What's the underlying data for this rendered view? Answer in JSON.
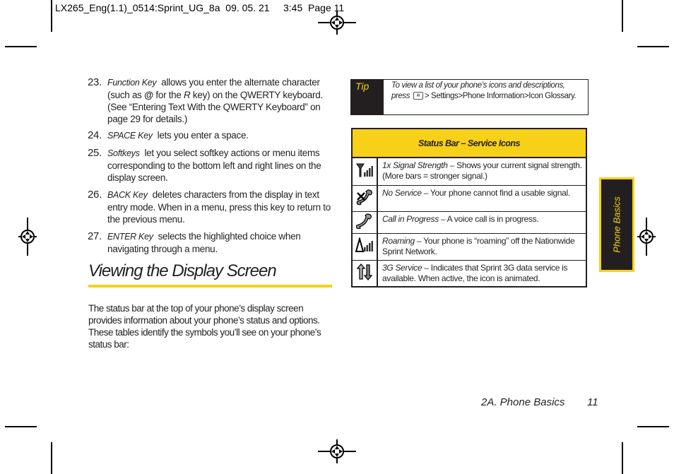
{
  "slug": "LX265_Eng(1.1)_0514:Sprint_UG_8a  09. 05. 21     3:45  Page 11",
  "list_items": [
    {
      "num": "23.",
      "key": "Function Key",
      "text_parts": [
        "allows you enter the alternate character (such as ",
        "@",
        " for the ",
        "R",
        " key) on the QWERTY keyboard. (See “Entering Text With the QWERTY Keyboard” on page 29 for details.)"
      ]
    },
    {
      "num": "24.",
      "key": "SPACE Key",
      "text": "lets you enter a space."
    },
    {
      "num": "25.",
      "key": "Softkeys",
      "text": "let you select softkey actions or menu items corresponding to the bottom left and right lines on the display screen."
    },
    {
      "num": "26.",
      "key": "BACK Key",
      "text": "deletes characters from the display in text entry mode. When in a menu, press this key to return to the previous menu."
    },
    {
      "num": "27.",
      "key": "ENTER Key",
      "text": "selects the highlighted choice when navigating through a menu."
    }
  ],
  "section": {
    "heading": "Viewing the Display Screen",
    "intro": "The status bar at the top of your phone’s display screen provides information about your phone’s status and options. These tables identify the symbols you’ll see on your phone’s status bar:"
  },
  "tip": {
    "label": "Tip",
    "text_italic": "To view a list of your phone’s icons and descriptions, press",
    "menu_key_label": "MENU OK",
    "path": [
      "Settings",
      "Phone Information",
      "Icon Glossary."
    ],
    "separator": ">"
  },
  "table": {
    "title": "Status Bar – Service Icons",
    "rows": [
      {
        "icon": "signal-strength-icon",
        "term": "1x Signal Strength –",
        "desc": " Shows your current signal strength. (More bars = stronger signal.)"
      },
      {
        "icon": "no-service-icon",
        "term": "No Service –",
        "desc": " Your phone cannot find a usable signal."
      },
      {
        "icon": "call-in-progress-icon",
        "term": "Call in Progress –",
        "desc": " A voice call is in progress."
      },
      {
        "icon": "roaming-icon",
        "term": "Roaming –",
        "desc": " Your phone is “roaming” off the Nationwide Sprint Network."
      },
      {
        "icon": "3g-service-icon",
        "term": "3G Service –",
        "desc": " Indicates that Sprint 3G data service is available. When active, the icon is animated."
      }
    ]
  },
  "side_tab": "Phone Basics",
  "footer": {
    "section": "2A. Phone Basics",
    "page": "11"
  },
  "colors": {
    "accent": "#f7d117",
    "dark": "#231f20"
  }
}
